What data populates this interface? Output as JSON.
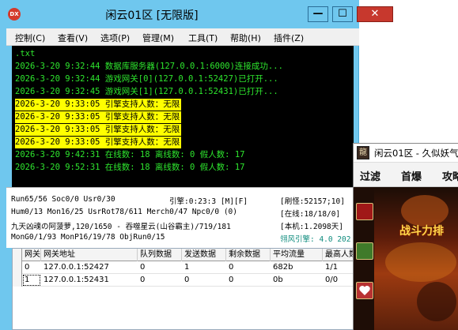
{
  "window": {
    "title": "闲云01区 [无限版]",
    "app_icon": "DX",
    "controls": {
      "minimize": "—",
      "maximize": "☐",
      "close": "✕"
    }
  },
  "menu": [
    {
      "label": "控制(C)"
    },
    {
      "label": "查看(V)"
    },
    {
      "label": "选项(P)"
    },
    {
      "label": "管理(M)"
    },
    {
      "label": "工具(T)"
    },
    {
      "label": "帮助(H)"
    },
    {
      "label": "插件(Z)"
    }
  ],
  "console": {
    "lines": [
      {
        "text": ".txt",
        "highlight": false
      },
      {
        "text": "2026-3-20  9:32:44  数据库服务器(127.0.0.1:6000)连接成功...",
        "highlight": false
      },
      {
        "text": "2026-3-20  9:32:44  游戏网关[0](127.0.0.1:52427)已打开...",
        "highlight": false
      },
      {
        "text": "2026-3-20  9:32:45  游戏网关[1](127.0.0.1:52431)已打开...",
        "highlight": false
      },
      {
        "text": "2026-3-20  9:33:05  引擎支持人数：无限",
        "highlight": true
      },
      {
        "text": "2026-3-20  9:33:05  引擎支持人数：无限",
        "highlight": true
      },
      {
        "text": "2026-3-20  9:33:05  引擎支持人数：无限",
        "highlight": true
      },
      {
        "text": "2026-3-20  9:33:05  引擎支持人数：无限",
        "highlight": true
      },
      {
        "text": "2026-3-20  9:42:31  在线数: 18  离线数: 0  假人数: 17",
        "highlight": false
      },
      {
        "text": "2026-3-20  9:52:31  在线数: 18  离线数: 0  假人数: 17",
        "highlight": false
      }
    ]
  },
  "status": {
    "line1_left": "Run65/56 Soc0/0 Usr0/30",
    "line1_engine": "引擎:0:23:3 [M][F]",
    "line1_right": "[刷怪:52157;10]",
    "line2_left": "Hum0/13 Mon16/25 UsrRot78/611 Merch0/47 Npc0/0 (0)",
    "line2_right": "[在线:18/18/0]",
    "line3_left": "九天凶魂の阿菠萝,120/1650 - 吞噬星云(山谷霸主)/719/181",
    "line3_right": "[本机:1.2098天]",
    "line4_left": "MonG0/1/93 MonP16/19/78 ObjRun0/15",
    "line4_right": "翎风引擎: 4.0 202"
  },
  "grid": {
    "headers": [
      "网关",
      "网关地址",
      "队列数据",
      "发送数据",
      "剩余数据",
      "平均流量",
      "最高人数"
    ],
    "rows": [
      [
        "0",
        "127.0.0.1:52427",
        "0",
        "1",
        "0",
        "682b",
        "1/1"
      ],
      [
        "1",
        "127.0.0.1:52431",
        "0",
        "0",
        "0",
        "0b",
        "0/0"
      ]
    ]
  },
  "game_window": {
    "title": "闲云01区 - 久似妖气",
    "icon_glyph": "龍",
    "toolbar": [
      "过滤",
      "首爆",
      "攻略"
    ],
    "banner": "战斗力排",
    "colors": {
      "banner": "#ffd84a"
    }
  },
  "colors": {
    "titlebar": "#6fc7ee",
    "console_bg": "#000000",
    "console_text": "#2ee62e",
    "highlight_bg": "#ffff00",
    "close_button": "#c7382d"
  }
}
